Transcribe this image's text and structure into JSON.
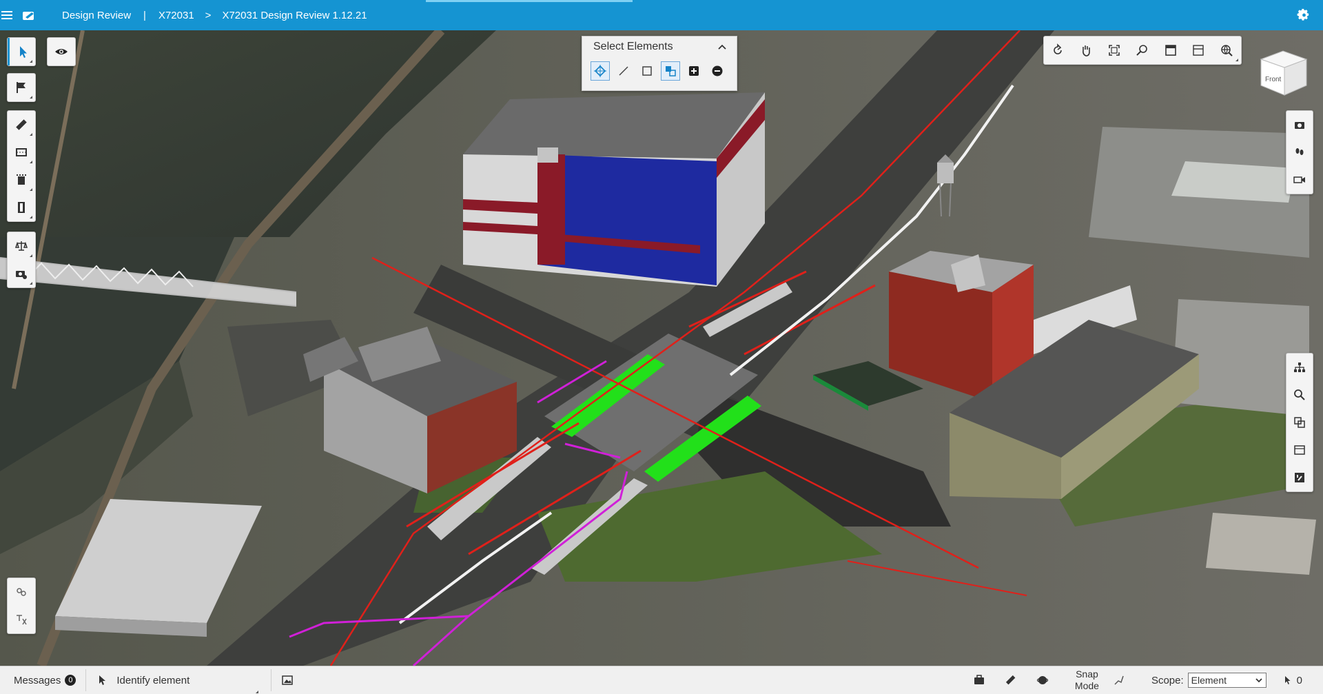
{
  "header": {
    "app_title": "Design Review",
    "separator": "|",
    "project": "X72031",
    "chevron": ">",
    "document": "X72031 Design Review 1.12.21"
  },
  "select_panel": {
    "title": "Select Elements",
    "tools": [
      "element-select-icon",
      "line-select-icon",
      "box-select-icon",
      "select-all-icon",
      "add-selection-icon",
      "remove-selection-icon"
    ]
  },
  "view_toolbar": {
    "tools": [
      "rotate-icon",
      "pan-icon",
      "fit-view-icon",
      "zoom-window-icon",
      "view-top-icon",
      "view-section-icon",
      "globe-icon"
    ]
  },
  "view_cube": {
    "face_label": "Front"
  },
  "left_toolbar": {
    "select": [
      "select-arrow-icon"
    ],
    "markup": [
      "flag-icon"
    ],
    "measure": [
      "ruler-icon",
      "section-box-icon",
      "clip-icon",
      "film-icon"
    ],
    "compare": [
      "scale-icon",
      "camera-settings-icon"
    ],
    "visibility": "eye-icon",
    "bottom": [
      "models-icon",
      "translate-icon"
    ]
  },
  "right_toolbar": {
    "top": [
      "camera-icon",
      "walk-icon",
      "video-icon"
    ],
    "bottom": [
      "tree-icon",
      "search-icon",
      "properties-icon",
      "sheets-icon",
      "issues-icon"
    ]
  },
  "statusbar": {
    "messages_label": "Messages",
    "messages_count": "0",
    "identify_label": "Identify element",
    "snap_line1": "Snap",
    "snap_line2": "Mode",
    "scope_label": "Scope:",
    "scope_value": "Element",
    "selection_count": "0"
  },
  "colors": {
    "header_blue": "#1594d2",
    "highlight_green": "#22e01a",
    "alignment_red": "#e0201a",
    "alignment_magenta": "#d020d8",
    "building_blue": "#1e2aa0",
    "building_maroon": "#8a1a28"
  }
}
